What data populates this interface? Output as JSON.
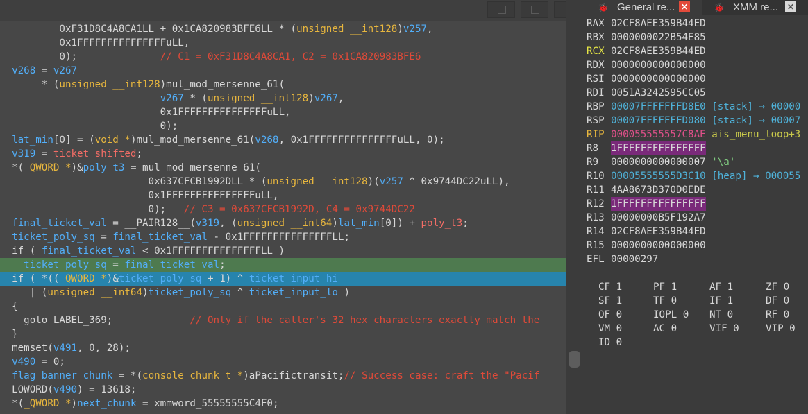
{
  "code_pane": {
    "lines": [
      {
        "indent": "          ",
        "tokens": [
          [
            "0xF31D8C4A8CA1LL + 0x1CA820983BFE6LL * (",
            "plain"
          ],
          [
            "unsigned __int128",
            "type"
          ],
          [
            ")",
            "plain"
          ],
          [
            "v257",
            "var"
          ],
          [
            ",",
            "plain"
          ]
        ]
      },
      {
        "indent": "          ",
        "tokens": [
          [
            "0x1FFFFFFFFFFFFFFFuLL,",
            "plain"
          ]
        ]
      },
      {
        "indent": "          ",
        "tokens": [
          [
            "0);",
            "plain"
          ],
          [
            "              // C1 = 0xF31D8C4A8CA1, C2 = 0x1CA820983BFE6",
            "cmt"
          ]
        ]
      },
      {
        "indent": "  ",
        "tokens": [
          [
            "v268",
            "var"
          ],
          [
            " = ",
            "plain"
          ],
          [
            "v267",
            "var"
          ]
        ]
      },
      {
        "indent": "       ",
        "tokens": [
          [
            "* (",
            "plain"
          ],
          [
            "unsigned __int128",
            "type"
          ],
          [
            ")mul_mod_mersenne_61(",
            "plain"
          ]
        ]
      },
      {
        "indent": "                           ",
        "tokens": [
          [
            "v267",
            "var"
          ],
          [
            " * (",
            "plain"
          ],
          [
            "unsigned __int128",
            "type"
          ],
          [
            ")",
            "plain"
          ],
          [
            "v267",
            "var"
          ],
          [
            ",",
            "plain"
          ]
        ]
      },
      {
        "indent": "                           ",
        "tokens": [
          [
            "0x1FFFFFFFFFFFFFFFuLL,",
            "plain"
          ]
        ]
      },
      {
        "indent": "                           ",
        "tokens": [
          [
            "0);",
            "plain"
          ]
        ]
      },
      {
        "indent": "  ",
        "tokens": [
          [
            "lat_min",
            "var"
          ],
          [
            "[0] = (",
            "plain"
          ],
          [
            "void *",
            "type"
          ],
          [
            ")mul_mod_mersenne_61(",
            "plain"
          ],
          [
            "v268",
            "var"
          ],
          [
            ", 0x1FFFFFFFFFFFFFFFuLL, 0);",
            "plain"
          ]
        ]
      },
      {
        "indent": "  ",
        "tokens": [
          [
            "v319",
            "var"
          ],
          [
            " = ",
            "plain"
          ],
          [
            "ticket_shifted",
            "glob"
          ],
          [
            ";",
            "plain"
          ]
        ]
      },
      {
        "indent": "  ",
        "tokens": [
          [
            "*(",
            "plain"
          ],
          [
            "_QWORD *",
            "type"
          ],
          [
            ")&",
            "plain"
          ],
          [
            "poly_t3",
            "var"
          ],
          [
            " = mul_mod_mersenne_61(",
            "plain"
          ]
        ]
      },
      {
        "indent": "                         ",
        "tokens": [
          [
            "0x637CFCB1992DLL * (",
            "plain"
          ],
          [
            "unsigned __int128",
            "type"
          ],
          [
            ")(",
            "plain"
          ],
          [
            "v257",
            "var"
          ],
          [
            " ^ 0x9744DC22uLL),",
            "plain"
          ]
        ]
      },
      {
        "indent": "                         ",
        "tokens": [
          [
            "0x1FFFFFFFFFFFFFFFuLL,",
            "plain"
          ]
        ]
      },
      {
        "indent": "                         ",
        "tokens": [
          [
            "0);",
            "plain"
          ],
          [
            "   // C3 = 0x637CFCB1992D, C4 = 0x9744DC22",
            "cmt"
          ]
        ]
      },
      {
        "indent": "  ",
        "tokens": [
          [
            "final_ticket_val",
            "var"
          ],
          [
            " = __PAIR128__(",
            "plain"
          ],
          [
            "v319",
            "var"
          ],
          [
            ", (",
            "plain"
          ],
          [
            "unsigned __int64",
            "type"
          ],
          [
            ")",
            "plain"
          ],
          [
            "lat_min",
            "var"
          ],
          [
            "[0]) + ",
            "plain"
          ],
          [
            "poly_t3",
            "glob"
          ],
          [
            ";",
            "plain"
          ]
        ]
      },
      {
        "indent": "  ",
        "tokens": [
          [
            "ticket_poly_sq",
            "var"
          ],
          [
            " = ",
            "plain"
          ],
          [
            "final_ticket_val",
            "var"
          ],
          [
            " - 0x1FFFFFFFFFFFFFFFLL;",
            "plain"
          ]
        ]
      },
      {
        "indent": "  ",
        "tokens": [
          [
            "if ( ",
            "plain"
          ],
          [
            "final_ticket_val",
            "var"
          ],
          [
            " < 0x1FFFFFFFFFFFFFFFLL )",
            "plain"
          ]
        ]
      },
      {
        "indent": "    ",
        "highlight": "green",
        "tokens": [
          [
            "ticket_poly_sq",
            "var"
          ],
          [
            " = ",
            "plain"
          ],
          [
            "final_ticket_val",
            "var"
          ],
          [
            ";",
            "plain"
          ]
        ]
      },
      {
        "indent": "  ",
        "highlight": "blue",
        "tokens": [
          [
            "if ( *((",
            "plain"
          ],
          [
            "_QWORD *",
            "type"
          ],
          [
            ")&",
            "plain"
          ],
          [
            "ticket_poly_sq",
            "var"
          ],
          [
            " + 1) ^ ",
            "plain"
          ],
          [
            "ticket_input_hi",
            "var"
          ]
        ]
      },
      {
        "indent": "     ",
        "tokens": [
          [
            "| (",
            "plain"
          ],
          [
            "unsigned __int64",
            "type"
          ],
          [
            ")",
            "plain"
          ],
          [
            "ticket_poly_sq",
            "var"
          ],
          [
            " ^ ",
            "plain"
          ],
          [
            "ticket_input_lo",
            "var"
          ],
          [
            " )",
            "plain"
          ]
        ]
      },
      {
        "indent": "  ",
        "tokens": [
          [
            "{",
            "plain"
          ]
        ]
      },
      {
        "indent": "    ",
        "tokens": [
          [
            "goto LABEL_369;",
            "plain"
          ],
          [
            "             // Only if the caller's 32 hex characters exactly match the",
            "cmt"
          ]
        ]
      },
      {
        "indent": "  ",
        "tokens": [
          [
            "}",
            "plain"
          ]
        ]
      },
      {
        "indent": "  ",
        "tokens": [
          [
            "memset(",
            "plain"
          ],
          [
            "v491",
            "var"
          ],
          [
            ", 0, 28);",
            "plain"
          ]
        ]
      },
      {
        "indent": "  ",
        "tokens": [
          [
            "v490",
            "var"
          ],
          [
            " = 0;",
            "plain"
          ]
        ]
      },
      {
        "indent": "  ",
        "tokens": [
          [
            "flag_banner_chunk",
            "var"
          ],
          [
            " = *(",
            "plain"
          ],
          [
            "console_chunk_t *",
            "type"
          ],
          [
            ")aPacifictransit;",
            "plain"
          ],
          [
            "// Success case: craft the \"Pacif",
            "cmt"
          ]
        ]
      },
      {
        "indent": "  ",
        "tokens": [
          [
            "LOWORD(",
            "plain"
          ],
          [
            "v490",
            "var"
          ],
          [
            ") = 13618;",
            "plain"
          ]
        ]
      },
      {
        "indent": "  ",
        "tokens": [
          [
            "*(",
            "plain"
          ],
          [
            "_QWORD *",
            "type"
          ],
          [
            ")",
            "plain"
          ],
          [
            "next_chunk",
            "var"
          ],
          [
            " = xmmword_55555555C4F0;",
            "plain"
          ]
        ]
      }
    ]
  },
  "tabs": [
    {
      "label": "General re...",
      "icon": "bug-icon",
      "active": true,
      "close": "✕"
    },
    {
      "label": "XMM re...",
      "icon": "bug-icon",
      "active": false,
      "close": "✕"
    }
  ],
  "registers": [
    {
      "name": "RAX",
      "value": "02CF8AEE359B44ED"
    },
    {
      "name": "RBX",
      "value": "0000000022B54E85"
    },
    {
      "name": "RCX",
      "value": "02CF8AEE359B44ED",
      "changed": true
    },
    {
      "name": "RDX",
      "value": "0000000000000000"
    },
    {
      "name": "RSI",
      "value": "0000000000000000"
    },
    {
      "name": "RDI",
      "value": "0051A3242595CC05"
    },
    {
      "name": "RBP",
      "value": "00007FFFFFFFD8E0",
      "kind": "stack",
      "suffix": " [stack] → 00000"
    },
    {
      "name": "RSP",
      "value": "00007FFFFFFFD080",
      "kind": "stack",
      "suffix": " [stack] → 00007"
    },
    {
      "name": "RIP",
      "value": "000055555557C8AE",
      "kind": "code",
      "suffix": " ais_menu_loop+3"
    },
    {
      "name": "R8",
      "value": "1FFFFFFFFFFFFFFF",
      "hl": true
    },
    {
      "name": "R9",
      "value": "0000000000000007",
      "suffix": " '\\a'"
    },
    {
      "name": "R10",
      "value": "00005555555D3C10",
      "kind": "stack",
      "suffix": " [heap] → 000055"
    },
    {
      "name": "R11",
      "value": "4AA8673D370D0EDE"
    },
    {
      "name": "R12",
      "value": "1FFFFFFFFFFFFFFF",
      "hl": true
    },
    {
      "name": "R13",
      "value": "00000000B5F192A7"
    },
    {
      "name": "R14",
      "value": "02CF8AEE359B44ED"
    },
    {
      "name": "R15",
      "value": "0000000000000000"
    },
    {
      "name": "EFL",
      "value": "00000297"
    }
  ],
  "flags": [
    [
      "CF",
      "1"
    ],
    [
      "PF",
      "1"
    ],
    [
      "AF",
      "1"
    ],
    [
      "ZF",
      "0"
    ],
    [
      "SF",
      "1"
    ],
    [
      "TF",
      "0"
    ],
    [
      "IF",
      "1"
    ],
    [
      "DF",
      "0"
    ],
    [
      "OF",
      "0"
    ],
    [
      "IOPL",
      "0"
    ],
    [
      "NT",
      "0"
    ],
    [
      "RF",
      "0"
    ],
    [
      "VM",
      "0"
    ],
    [
      "AC",
      "0"
    ],
    [
      "VIF",
      "0"
    ],
    [
      "VIP",
      "0"
    ],
    [
      "ID",
      "0"
    ]
  ]
}
